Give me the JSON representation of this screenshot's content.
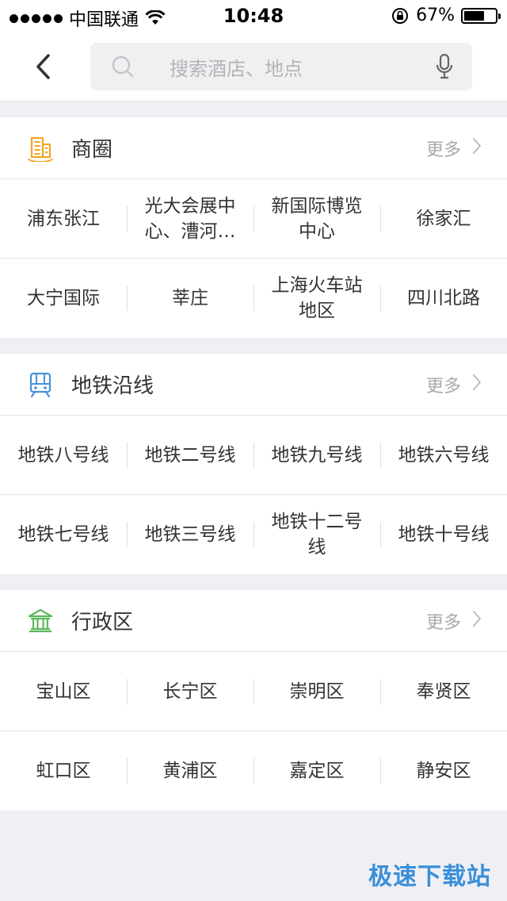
{
  "status_bar": {
    "carrier": "中国联通",
    "time": "10:48",
    "battery_percent": "67%",
    "battery_level": 0.67
  },
  "search": {
    "placeholder": "搜索酒店、地点"
  },
  "sections": [
    {
      "title": "商圈",
      "more": "更多",
      "icon": "building-icon",
      "color": "#f5a623",
      "rows": [
        [
          "浦东张江",
          "光大会展中心、漕河…",
          "新国际博览中心",
          "徐家汇"
        ],
        [
          "大宁国际",
          "莘庄",
          "上海火车站地区",
          "四川北路"
        ]
      ]
    },
    {
      "title": "地铁沿线",
      "more": "更多",
      "icon": "metro-icon",
      "color": "#4a90d9",
      "rows": [
        [
          "地铁八号线",
          "地铁二号线",
          "地铁九号线",
          "地铁六号线"
        ],
        [
          "地铁七号线",
          "地铁三号线",
          "地铁十二号线",
          "地铁十号线"
        ]
      ]
    },
    {
      "title": "行政区",
      "more": "更多",
      "icon": "government-building-icon",
      "color": "#5cb85c",
      "rows": [
        [
          "宝山区",
          "长宁区",
          "崇明区",
          "奉贤区"
        ],
        [
          "虹口区",
          "黄浦区",
          "嘉定区",
          "静安区"
        ]
      ]
    }
  ],
  "watermark": "极速下载站"
}
